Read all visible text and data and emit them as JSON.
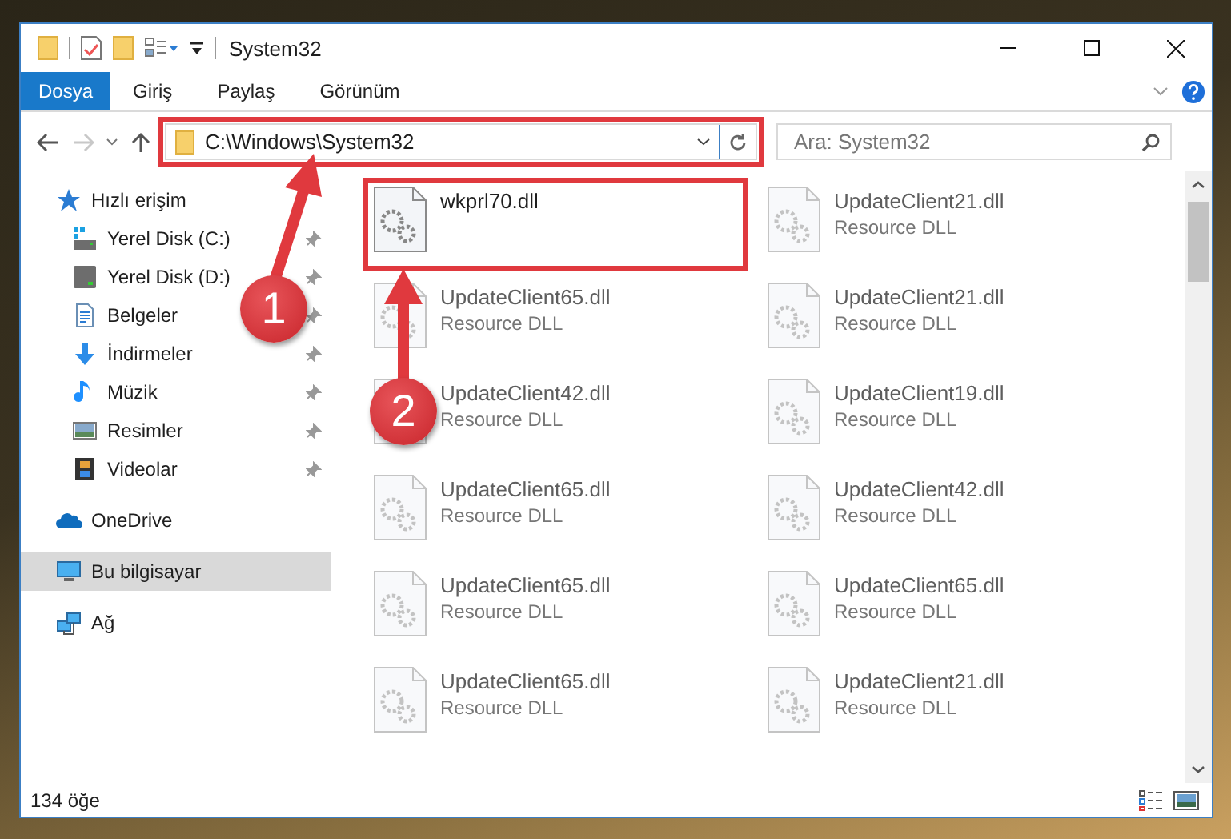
{
  "window": {
    "title": "System32"
  },
  "ribbon": {
    "tabs": [
      {
        "label": "Dosya",
        "kind": "file",
        "selected": false
      },
      {
        "label": "Giriş",
        "kind": "tab",
        "selected": false
      },
      {
        "label": "Paylaş",
        "kind": "tab",
        "selected": false
      },
      {
        "label": "Görünüm",
        "kind": "tab",
        "selected": false
      }
    ]
  },
  "address": {
    "path": "C:\\Windows\\System32",
    "highlighted": true,
    "back_disabled": false,
    "forward_disabled": true
  },
  "search": {
    "placeholder": "Ara: System32"
  },
  "sidebar": {
    "items": [
      {
        "label": "Hızlı erişim",
        "selected": false,
        "children": [
          {
            "label": "Yerel Disk (C:)",
            "pinned": true,
            "selected": false
          },
          {
            "label": "Yerel Disk (D:)",
            "pinned": true,
            "selected": false
          },
          {
            "label": "Belgeler",
            "pinned": true,
            "selected": false
          },
          {
            "label": "İndirmeler",
            "pinned": true,
            "selected": false
          },
          {
            "label": "Müzik",
            "pinned": true,
            "selected": false
          },
          {
            "label": "Resimler",
            "pinned": true,
            "selected": false
          },
          {
            "label": "Videolar",
            "pinned": true,
            "selected": false
          }
        ]
      },
      {
        "label": "OneDrive",
        "selected": false
      },
      {
        "label": "Bu bilgisayar",
        "selected": true
      },
      {
        "label": "Ağ",
        "selected": false
      }
    ]
  },
  "files": [
    {
      "name": "wkprl70.dll",
      "highlighted": true
    },
    {
      "name": "UpdateClient21.dll",
      "type": "Resource DLL",
      "highlighted": false
    },
    {
      "name": "UpdateClient65.dll",
      "type": "Resource DLL",
      "highlighted": false
    },
    {
      "name": "UpdateClient21.dll",
      "type": "Resource DLL",
      "highlighted": false
    },
    {
      "name": "UpdateClient42.dll",
      "type": "Resource DLL",
      "highlighted": false
    },
    {
      "name": "UpdateClient19.dll",
      "type": "Resource DLL",
      "highlighted": false
    },
    {
      "name": "UpdateClient65.dll",
      "type": "Resource DLL",
      "highlighted": false
    },
    {
      "name": "UpdateClient42.dll",
      "type": "Resource DLL",
      "highlighted": false
    },
    {
      "name": "UpdateClient65.dll",
      "type": "Resource DLL",
      "highlighted": false
    },
    {
      "name": "UpdateClient65.dll",
      "type": "Resource DLL",
      "highlighted": false
    },
    {
      "name": "UpdateClient65.dll",
      "type": "Resource DLL",
      "highlighted": false
    },
    {
      "name": "UpdateClient21.dll",
      "type": "Resource DLL",
      "highlighted": false
    }
  ],
  "status_bar": {
    "count": "134 öğe"
  },
  "annotations": [
    {
      "number": "1"
    },
    {
      "number": "2"
    }
  ]
}
